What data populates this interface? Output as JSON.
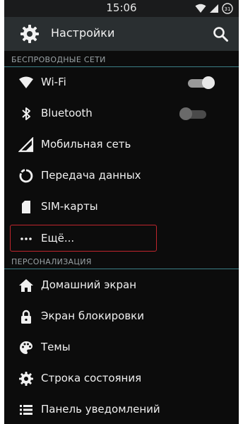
{
  "status_bar": {
    "time": "15:06",
    "battery_level": "31"
  },
  "toolbar": {
    "title": "Настройки",
    "icons": [
      "gear-icon",
      "search-icon"
    ]
  },
  "sections": {
    "wireless": "БЕСПРОВОДНЫЕ СЕТИ",
    "personal": "ПЕРСОНАЛИЗАЦИЯ"
  },
  "wireless_items": [
    {
      "label": "Wi-Fi",
      "icon": "wifi-icon",
      "toggle": "on"
    },
    {
      "label": "Bluetooth",
      "icon": "bluetooth-icon",
      "toggle": "off"
    },
    {
      "label": "Мобильная сеть",
      "icon": "signal-icon"
    },
    {
      "label": "Передача данных",
      "icon": "data-usage-icon"
    },
    {
      "label": "SIM-карты",
      "icon": "sim-card-icon"
    },
    {
      "label": "Ещё...",
      "icon": "more-icon",
      "highlighted": true
    }
  ],
  "personal_items": [
    {
      "label": "Домашний экран",
      "icon": "home-icon"
    },
    {
      "label": "Экран блокировки",
      "icon": "lock-icon"
    },
    {
      "label": "Темы",
      "icon": "palette-icon"
    },
    {
      "label": "Строка состояния",
      "icon": "settings-gear-icon"
    },
    {
      "label": "Панель уведомлений",
      "icon": "list-icon"
    }
  ],
  "colors": {
    "background": "#0c0c0c",
    "toolbar": "#2a2f31",
    "section_divider": "#3c7f86",
    "highlight_box": "#c0262d",
    "toggle_on": "#e0e0e0",
    "toggle_off": "#6a6a6a"
  }
}
